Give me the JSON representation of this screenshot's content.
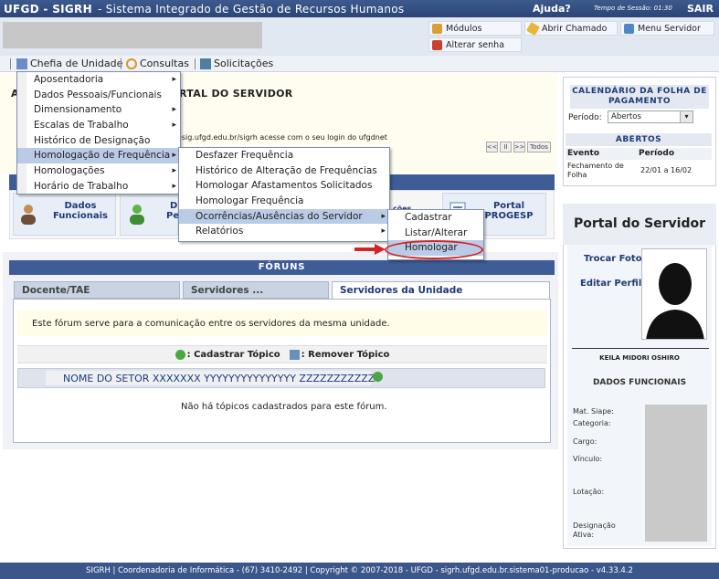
{
  "topbar": {
    "system": "UFGD - SIGRH",
    "subtitle": "- Sistema Integrado de Gestão de Recursos Humanos",
    "help": "Ajuda?",
    "session": "Tempo de Sessão: 01:30",
    "logout": "SAIR"
  },
  "quick_buttons": {
    "modulos": "Módulos",
    "abrir_chamado": "Abrir Chamado",
    "menu_servidor": "Menu Servidor",
    "alterar_senha": "Alterar senha"
  },
  "menubar": {
    "chefia": "Chefia de Unidade",
    "consultas": "Consultas",
    "solicitacoes": "Solicitações"
  },
  "header": {
    "letter": "A",
    "portal_title": "RTAL DO SERVIDOR",
    "login_note": "-sig.ufgd.edu.br/sigrh    acesse com o seu login do ufgdnet"
  },
  "pager": {
    "first": "<<",
    "pause": "II",
    "next": ">>",
    "all": "Todos"
  },
  "menu_chefia": [
    "Aposentadoria",
    "Dados Pessoais/Funcionais",
    "Dimensionamento",
    "Escalas de Trabalho",
    "Histórico de Designação",
    "Homologação de Frequência",
    "Homologações",
    "Horário de Trabalho"
  ],
  "menu_homologacao": [
    "Desfazer Frequência",
    "Histórico de Alteração de Frequências",
    "Homologar Afastamentos Solicitados",
    "Homologar Frequência",
    "Ocorrências/Ausências do Servidor",
    "Relatórios"
  ],
  "menu_ocorrencias": [
    "Cadastrar",
    "Listar/Alterar",
    "Homologar"
  ],
  "quick_cards": {
    "dados_funcionais": "Dados\nFuncionais",
    "d_pe_1": "D",
    "d_pe_2": "Pe",
    "hidden_partial": "ções",
    "portal_progesp": "Portal\nPROGESP"
  },
  "forum": {
    "title": "FÓRUNS",
    "tabs": [
      "Docente/TAE",
      "Servidores ...",
      "Servidores da Unidade"
    ],
    "description": "Este fórum serve para a comunicação entre os servidores da mesma unidade.",
    "add_topic": ": Cadastrar Tópico",
    "remove_topic": ": Remover Tópico",
    "setor": "NOME DO SETOR XXXXXXX YYYYYYYYYYYYYYY ZZZZZZZZZZZ",
    "empty": "Não há tópicos cadastrados para este fórum."
  },
  "calendar": {
    "title": "CALENDÁRIO DA FOLHA DE PAGAMENTO",
    "periodo_label": "Período:",
    "periodo_value": "Abertos",
    "abertos": "ABERTOS",
    "col_evento": "Evento",
    "col_periodo": "Período",
    "row_evento": "Fechamento de Folha",
    "row_periodo": "22/01 a 16/02"
  },
  "portal": {
    "title": "Portal do Servidor",
    "trocar_foto": "Trocar Foto",
    "editar_perfil": "Editar Perfil",
    "name": "KEILA MIDORI OSHIRO",
    "dados_funcionais": "DADOS FUNCIONAIS",
    "labels": [
      "Mat. Siape:",
      "Categoria:",
      "Cargo:",
      "Vínculo:",
      "Lotação:",
      "Designação Ativa:"
    ]
  },
  "footer": "SIGRH | Coordenadoria de Informática - (67) 3410-2492 | Copyright © 2007-2018 - UFGD - sigrh.ufgd.edu.br.sistema01-producao - v4.33.4.2",
  "colors": {
    "primary": "#3e5c95",
    "highlight": "#b9cbe6",
    "annotation": "#d62222"
  }
}
